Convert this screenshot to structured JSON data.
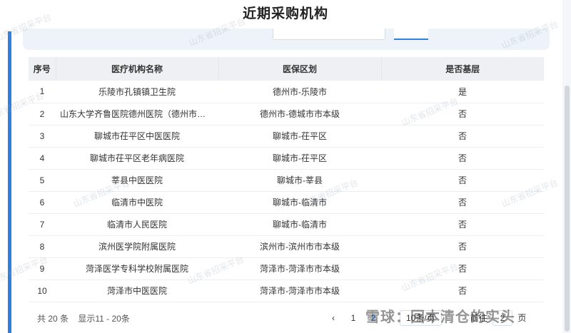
{
  "dialog": {
    "title": "近期采购机构"
  },
  "table": {
    "headers": [
      "序号",
      "医疗机构名称",
      "医保区划",
      "是否基层"
    ],
    "rows": [
      [
        "1",
        "乐陵市孔镇镇卫生院",
        "德州市-乐陵市",
        "是"
      ],
      [
        "2",
        "山东大学齐鲁医院德州医院（德州市人民医院）",
        "德州市-德城市市本级",
        "否"
      ],
      [
        "3",
        "聊城市茌平区中医医院",
        "聊城市-茌平区",
        "否"
      ],
      [
        "4",
        "聊城市茌平区老年病医院",
        "聊城市-茌平区",
        "否"
      ],
      [
        "5",
        "莘县中医医院",
        "聊城市-莘县",
        "否"
      ],
      [
        "6",
        "临清市中医院",
        "聊城市-临清市",
        "否"
      ],
      [
        "7",
        "临清市人民医院",
        "聊城市-临清市",
        "否"
      ],
      [
        "8",
        "滨州医学院附属医院",
        "滨州市-滨州市市本级",
        "否"
      ],
      [
        "9",
        "菏泽医学专科学校附属医院",
        "菏泽市-菏泽市市本级",
        "否"
      ],
      [
        "10",
        "菏泽市中医医院",
        "菏泽市-菏泽市市本级",
        "否"
      ]
    ]
  },
  "footer": {
    "total": "共 20 条",
    "range": "显示11 - 20条"
  },
  "pager": {
    "prev": "‹",
    "pages": [
      "1",
      "2"
    ],
    "active": "2",
    "page_size": "10条/页",
    "goto_label": "前往",
    "goto_value": "2",
    "goto_unit": "页"
  },
  "watermark": "山东省招采平台",
  "brand": "雪球：回本清仓的实头"
}
